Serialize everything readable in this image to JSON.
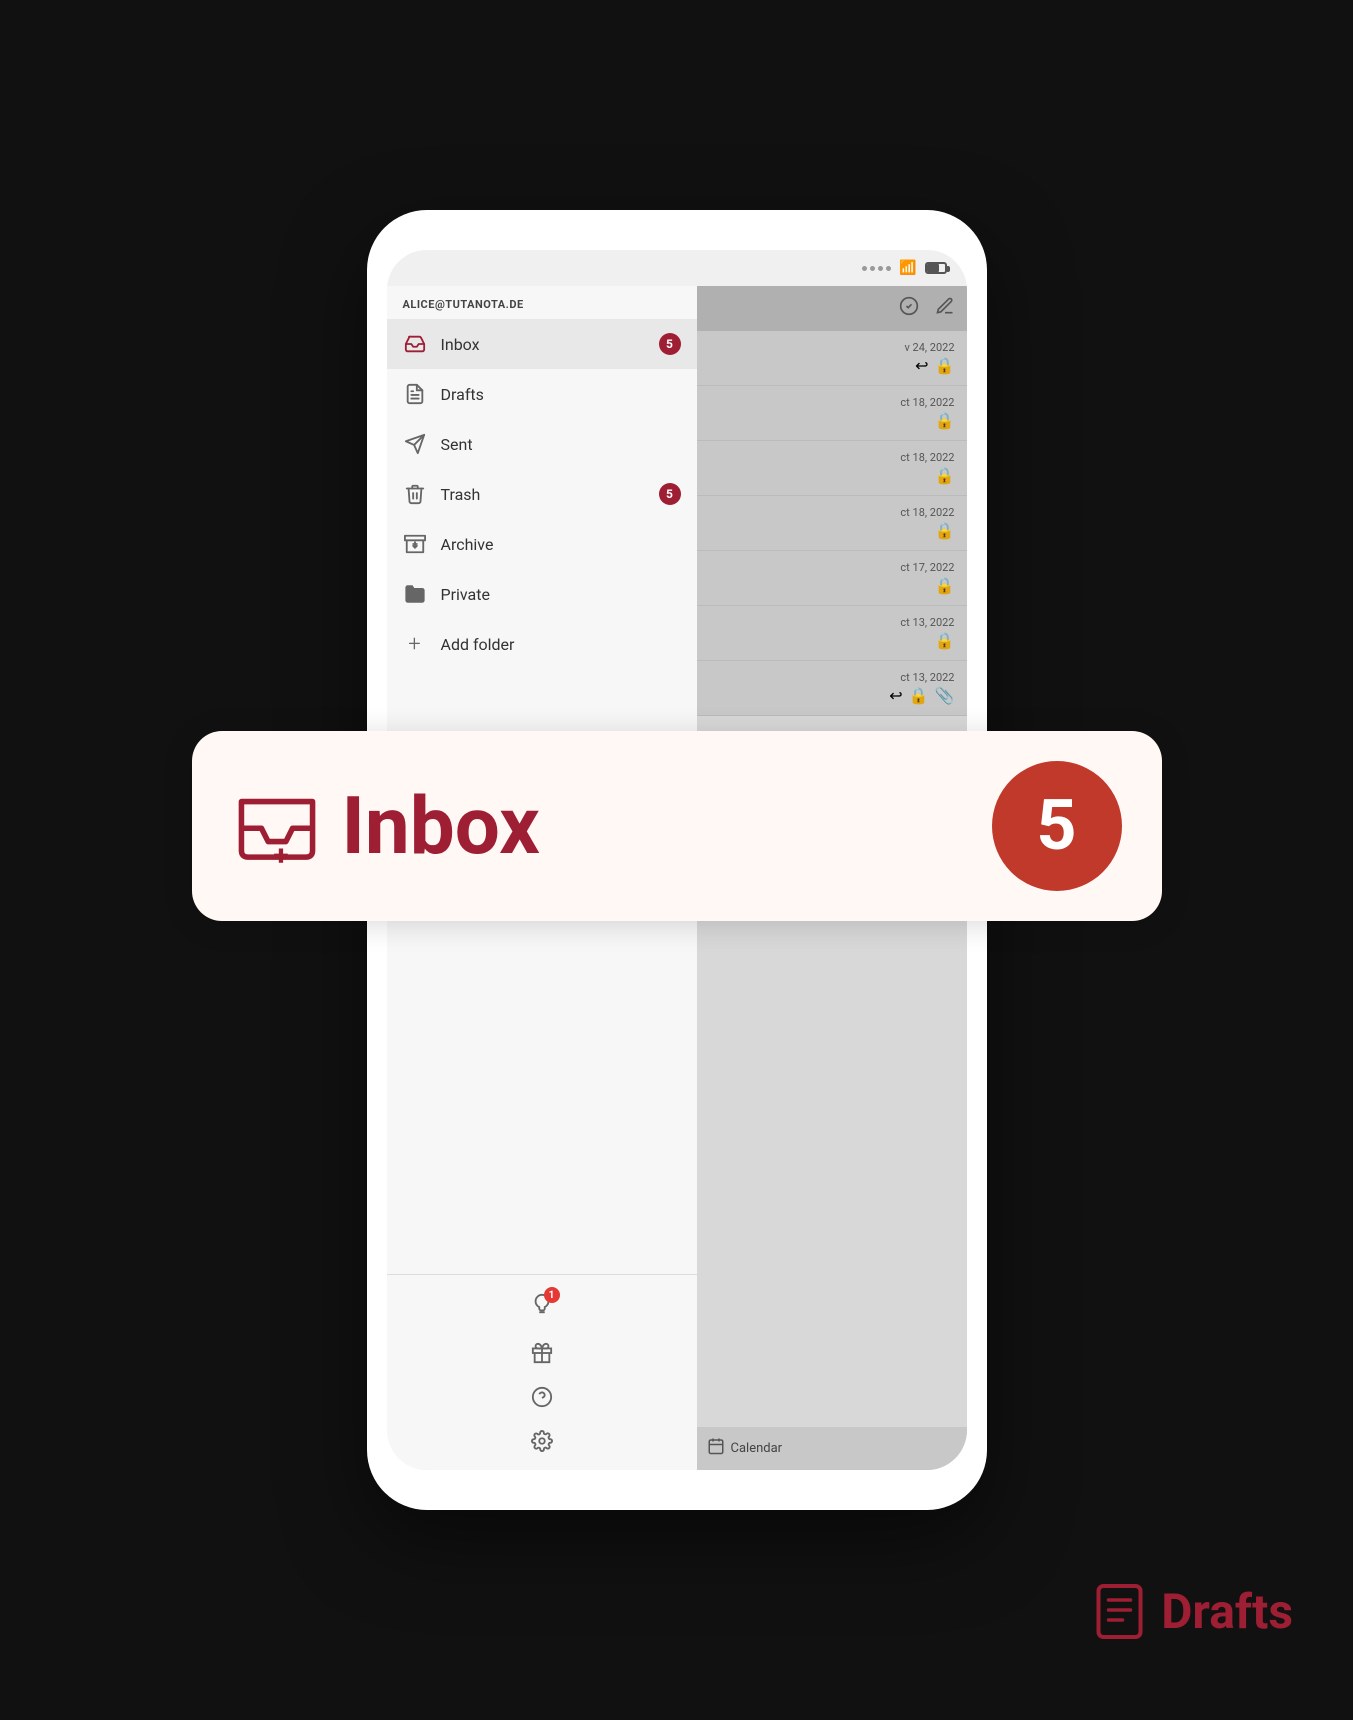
{
  "phone": {
    "status_bar": {
      "dots": 4,
      "wifi": "wifi",
      "battery": "battery"
    }
  },
  "sidebar": {
    "email": "ALICE@TUTANOTA.DE",
    "menu_items": [
      {
        "id": "inbox",
        "label": "Inbox",
        "icon": "inbox",
        "badge": "5",
        "active": true
      },
      {
        "id": "drafts",
        "label": "Drafts",
        "icon": "drafts",
        "badge": null,
        "active": false
      },
      {
        "id": "sent",
        "label": "Sent",
        "icon": "sent",
        "badge": null,
        "active": false
      },
      {
        "id": "trash",
        "label": "Trash",
        "icon": "trash",
        "badge": "5",
        "active": false
      },
      {
        "id": "archive",
        "label": "Archive",
        "icon": "archive",
        "badge": null,
        "active": false
      },
      {
        "id": "private",
        "label": "Private",
        "icon": "folder",
        "badge": null,
        "active": false
      },
      {
        "id": "add-folder",
        "label": "Add folder",
        "icon": "plus",
        "badge": null,
        "active": false
      }
    ],
    "bottom_icons": [
      {
        "id": "tip",
        "icon": "💡",
        "badge": "1"
      },
      {
        "id": "gift",
        "icon": "🎁",
        "badge": null
      },
      {
        "id": "help",
        "icon": "❓",
        "badge": null
      },
      {
        "id": "settings",
        "icon": "⚙️",
        "badge": null
      }
    ]
  },
  "email_panel": {
    "header_icons": [
      "check-circle",
      "compose"
    ],
    "emails": [
      {
        "date": "v 24, 2022",
        "icons": [
          "reply",
          "lock"
        ]
      },
      {
        "date": "ct 18, 2022",
        "icons": [
          "lock"
        ]
      },
      {
        "date": "ct 18, 2022",
        "icons": [
          "lock"
        ]
      },
      {
        "date": "ct 18, 2022",
        "icons": [
          "lock"
        ]
      },
      {
        "date": "ct 17, 2022",
        "icons": [
          "lock"
        ]
      },
      {
        "date": "ct 13, 2022",
        "icons": [
          "lock"
        ]
      },
      {
        "date": "ct 13, 2022",
        "icons": [
          "reply",
          "lock",
          "attachment"
        ]
      }
    ],
    "calendar_tab": {
      "label": "Calendar"
    }
  },
  "tooltip": {
    "label": "Inbox",
    "badge": "5"
  },
  "drafts_label": {
    "text": "Drafts"
  }
}
